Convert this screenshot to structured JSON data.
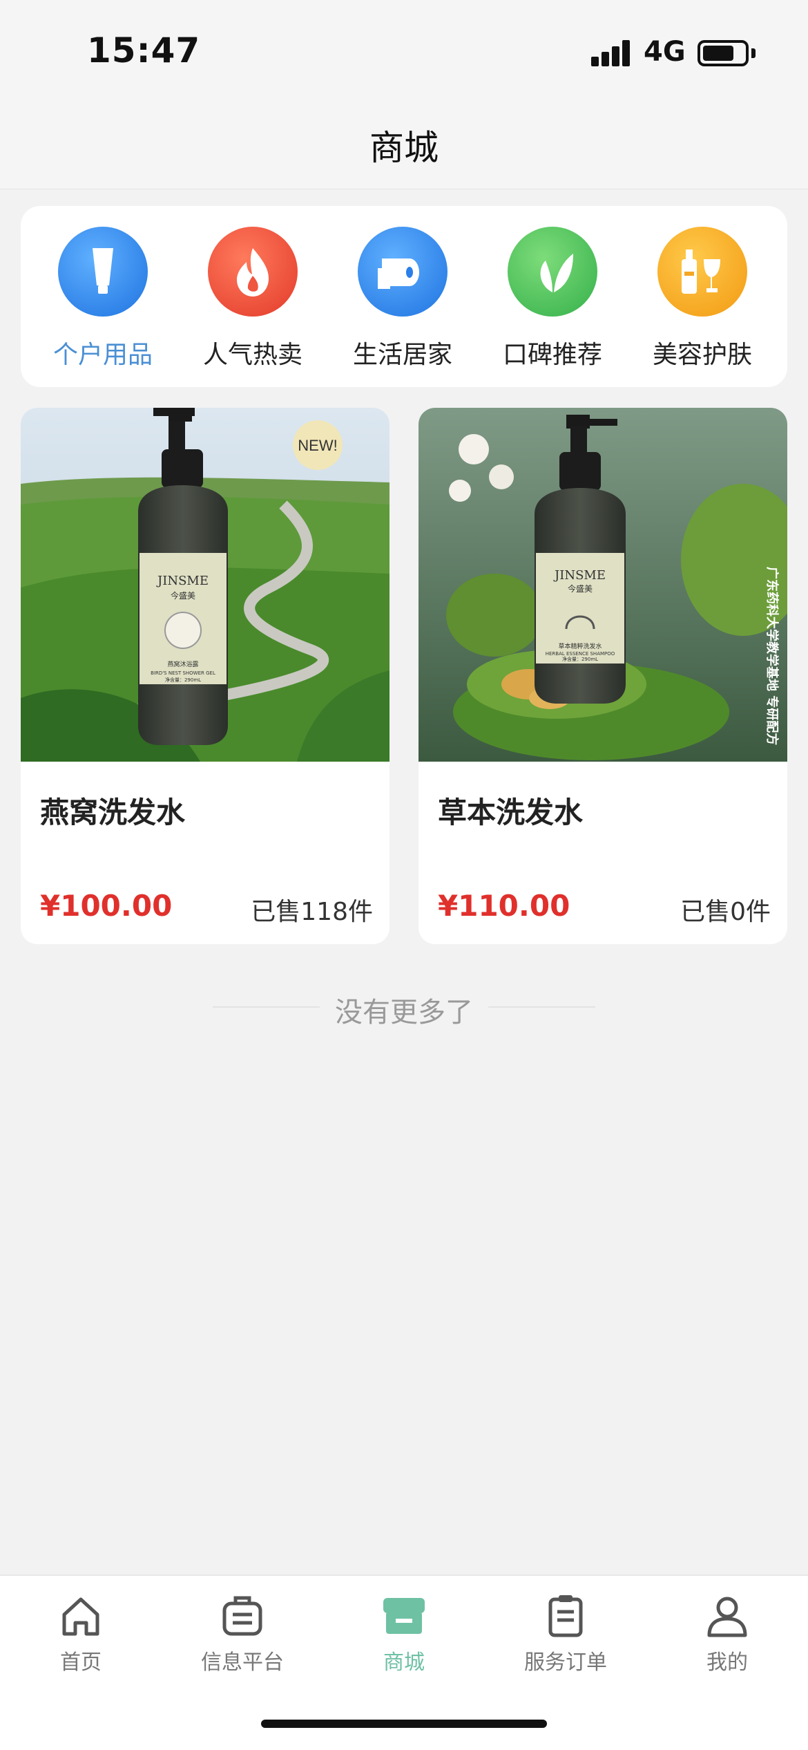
{
  "status_bar": {
    "time": "15:47",
    "network": "4G"
  },
  "header": {
    "title": "商城"
  },
  "categories": [
    {
      "label": "个户用品",
      "icon": "lotion-tube-icon",
      "color": "#3a8ff0",
      "active": true
    },
    {
      "label": "人气热卖",
      "icon": "flame-icon",
      "color": "#ef4b3c",
      "active": false
    },
    {
      "label": "生活居家",
      "icon": "toilet-paper-icon",
      "color": "#3a8ff0",
      "active": false
    },
    {
      "label": "口碑推荐",
      "icon": "leaf-icon",
      "color": "#4cc25c",
      "active": false
    },
    {
      "label": "美容护肤",
      "icon": "bottle-glass-icon",
      "color": "#f5a623",
      "active": false
    }
  ],
  "products": [
    {
      "name": "燕窝洗发水",
      "price": "¥100.00",
      "sold": "已售118件",
      "badge": "NEW!",
      "brand": "JINSME",
      "brand_cn": "今盛美",
      "label_text": "燕窝沐浴露",
      "label_en": "BIRD'S NEST SHOWER GEL",
      "net": "净含量：290mL"
    },
    {
      "name": "草本洗发水",
      "price": "¥110.00",
      "sold": "已售0件",
      "brand": "JINSME",
      "brand_cn": "今盛美",
      "label_text": "草本精粹洗发水",
      "label_en": "HERBAL ESSENCE SHAMPOO",
      "net": "净含量：290mL",
      "side_text": "广东药科大学教学基地 专研配方"
    },
    {
      "placeholder": null
    }
  ],
  "list_end": {
    "text": "没有更多了"
  },
  "tabbar": {
    "items": [
      {
        "label": "首页",
        "icon": "home-icon",
        "active": false
      },
      {
        "label": "信息平台",
        "icon": "message-board-icon",
        "active": false
      },
      {
        "label": "商城",
        "icon": "store-icon",
        "active": true
      },
      {
        "label": "服务订单",
        "icon": "clipboard-icon",
        "active": false
      },
      {
        "label": "我的",
        "icon": "user-icon",
        "active": false
      }
    ]
  },
  "colors": {
    "accent_blue": "#4a8fd4",
    "price_red": "#e0302c",
    "tab_active": "#6fc1a4"
  }
}
